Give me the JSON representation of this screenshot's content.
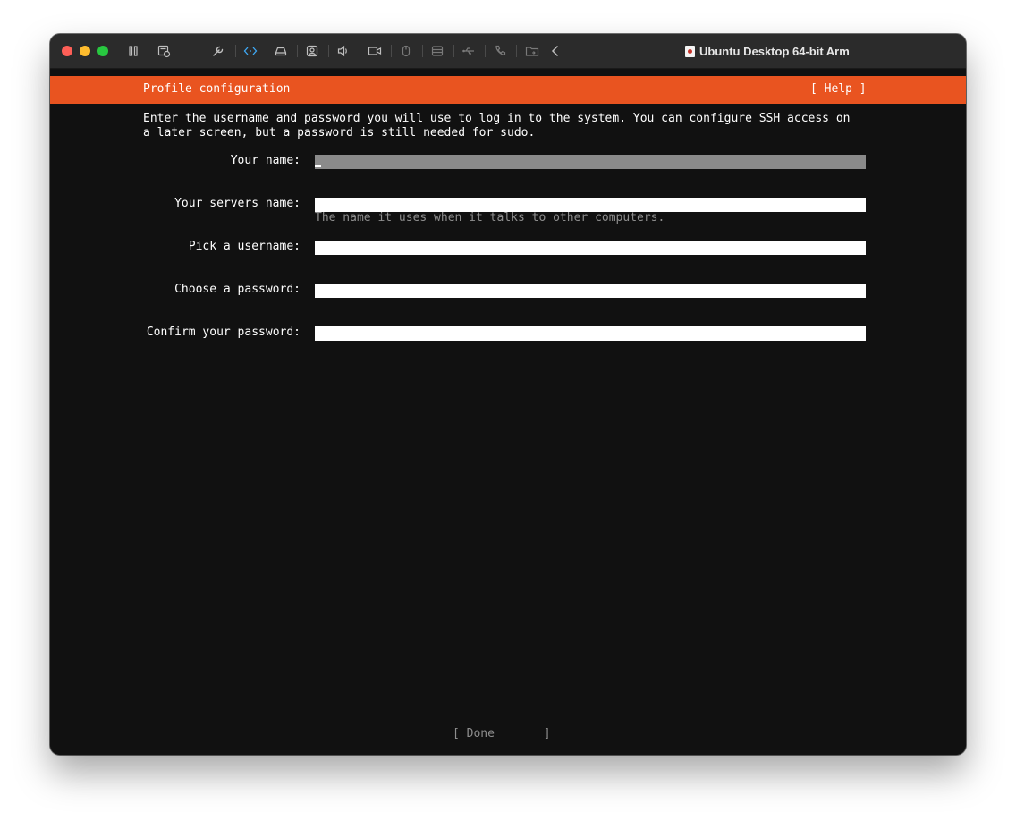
{
  "window": {
    "title": "Ubuntu Desktop 64-bit Arm"
  },
  "toolbar": {
    "icons": [
      "pause-icon",
      "snapshot-icon",
      "wrench-icon",
      "code-arrows-icon",
      "drive-icon",
      "camera-user-icon",
      "speaker-icon",
      "video-icon",
      "mouse-icon",
      "storage-icon",
      "usb-icon",
      "phone-icon",
      "folder-share-icon",
      "chevron-left-icon"
    ],
    "accent": "#3fa9f5"
  },
  "installer": {
    "header_title": "Profile configuration",
    "help_label": "[ Help ]",
    "intro_line1": "Enter the username and password you will use to log in to the system. You can configure SSH access on",
    "intro_line2": "a later screen, but a password is still needed for sudo.",
    "fields": [
      {
        "label": "Your name:",
        "value": ""
      },
      {
        "label": "Your servers name:",
        "value": "",
        "hint": "The name it uses when it talks to other computers."
      },
      {
        "label": "Pick a username:",
        "value": ""
      },
      {
        "label": "Choose a password:",
        "value": ""
      },
      {
        "label": "Confirm your password:",
        "value": ""
      }
    ],
    "done_label": "[ Done       ]",
    "colors": {
      "header": "#e95420",
      "background": "#111111",
      "active_field": "#8a8a8a",
      "hint": "#8e8e8e"
    }
  }
}
